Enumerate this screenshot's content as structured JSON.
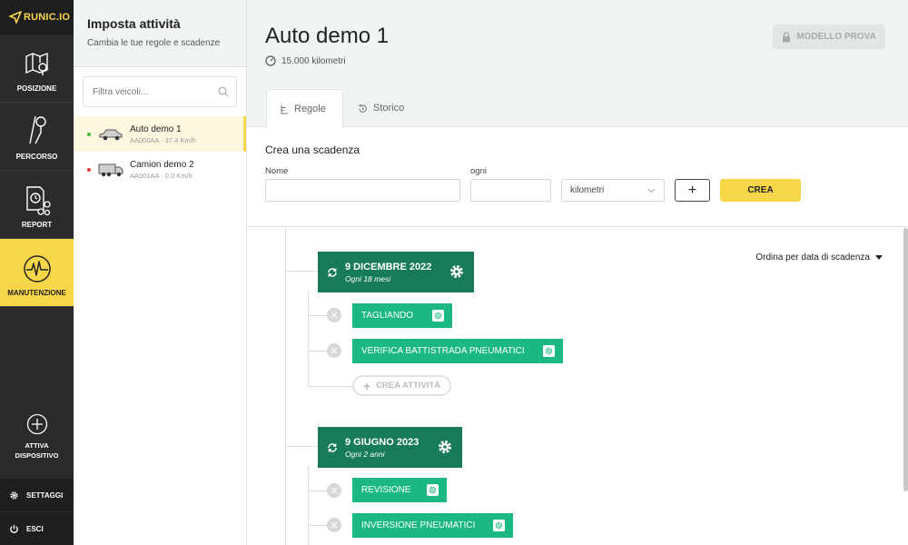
{
  "app": {
    "logo": "RUNIC.IO"
  },
  "nav": {
    "items": [
      {
        "label": "POSIZIONE",
        "icon": "map-icon"
      },
      {
        "label": "PERCORSO",
        "icon": "route-icon"
      },
      {
        "label": "REPORT",
        "icon": "report-icon"
      },
      {
        "label": "MANUTENZIONE",
        "icon": "maintenance-icon",
        "active": true
      }
    ],
    "add_device": {
      "line1": "ATTIVA",
      "line2": "DISPOSITIVO",
      "icon": "plus-circle-icon"
    },
    "settings": {
      "label": "SETTAGGI",
      "icon": "gear-icon"
    },
    "logout": {
      "label": "ESCI",
      "icon": "power-icon"
    }
  },
  "vehicles_panel": {
    "title": "Imposta attività",
    "subtitle": "Cambia le tue regole e scadenze",
    "search_placeholder": "Filtra veicoli...",
    "vehicles": [
      {
        "name": "Auto demo 1",
        "meta": "AA000AA · 37.4 Km/h",
        "status_color": "#3cbf3c",
        "type": "car",
        "selected": true
      },
      {
        "name": "Camion demo 2",
        "meta": "AA001AA · 0.0 Km/h",
        "status_color": "#e23a3a",
        "type": "truck",
        "selected": false
      }
    ]
  },
  "main": {
    "vehicle_name": "Auto demo 1",
    "odometer": "15.000 kilometri",
    "template_button": "MODELLO PROVA",
    "tabs": [
      {
        "label": "Regole",
        "active": true
      },
      {
        "label": "Storico",
        "active": false
      }
    ],
    "create": {
      "title": "Crea una scadenza",
      "name_label": "Nome",
      "every_label": "ogni",
      "unit_value": "kilometri",
      "plus_label": "+",
      "create_label": "CREA"
    },
    "sort_label": "Ordina per data di scadenza",
    "deadlines": [
      {
        "date": "9 DICEMBRE 2022",
        "every": "Ogni 18 mesi",
        "tasks": [
          "TAGLIANDO",
          "VERIFICA BATTISTRADA PNEUMATICI"
        ],
        "new_task_label": "CREA ATTIVITÀ"
      },
      {
        "date": "9 GIUGNO 2023",
        "every": "Ogni 2 anni",
        "tasks": [
          "REVISIONE",
          "INVERSIONE PNEUMATICI"
        ]
      }
    ]
  },
  "colors": {
    "accent": "#f7d64a",
    "deadline": "#177a5b",
    "task": "#1bb981",
    "nav_bg": "#2b2b2b"
  }
}
